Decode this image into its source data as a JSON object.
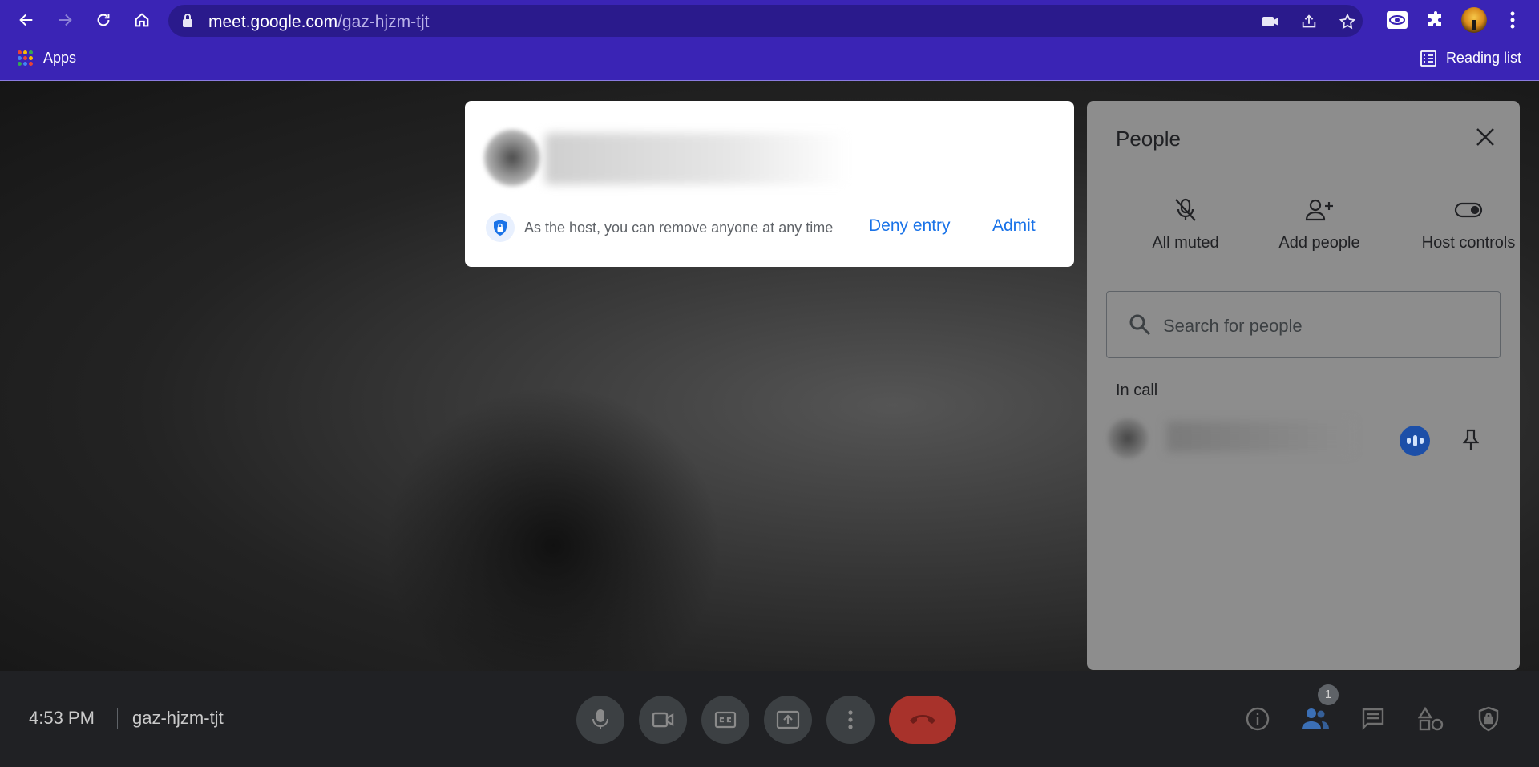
{
  "browser": {
    "url_host": "meet.google.com",
    "url_path": "/gaz-hjzm-tjt",
    "bookmarks": {
      "apps_label": "Apps",
      "reading_list_label": "Reading list"
    }
  },
  "dialog": {
    "info_text": "As the host, you can remove anyone at any time",
    "deny_label": "Deny entry",
    "admit_label": "Admit"
  },
  "people_panel": {
    "title": "People",
    "controls": [
      {
        "label": "All muted",
        "icon": "mic-off-icon"
      },
      {
        "label": "Add people",
        "icon": "person-add-icon"
      },
      {
        "label": "Host controls",
        "icon": "toggle-icon"
      }
    ],
    "search_placeholder": "Search for people",
    "section_label": "In call"
  },
  "bottom_bar": {
    "time": "4:53 PM",
    "meeting_code": "gaz-hjzm-tjt",
    "participants_count": "1"
  },
  "colors": {
    "chrome_bg": "#3a24b5",
    "accent_blue": "#1a73e8",
    "end_call_red": "#a8322b",
    "panel_bg": "#8d8d8d"
  }
}
